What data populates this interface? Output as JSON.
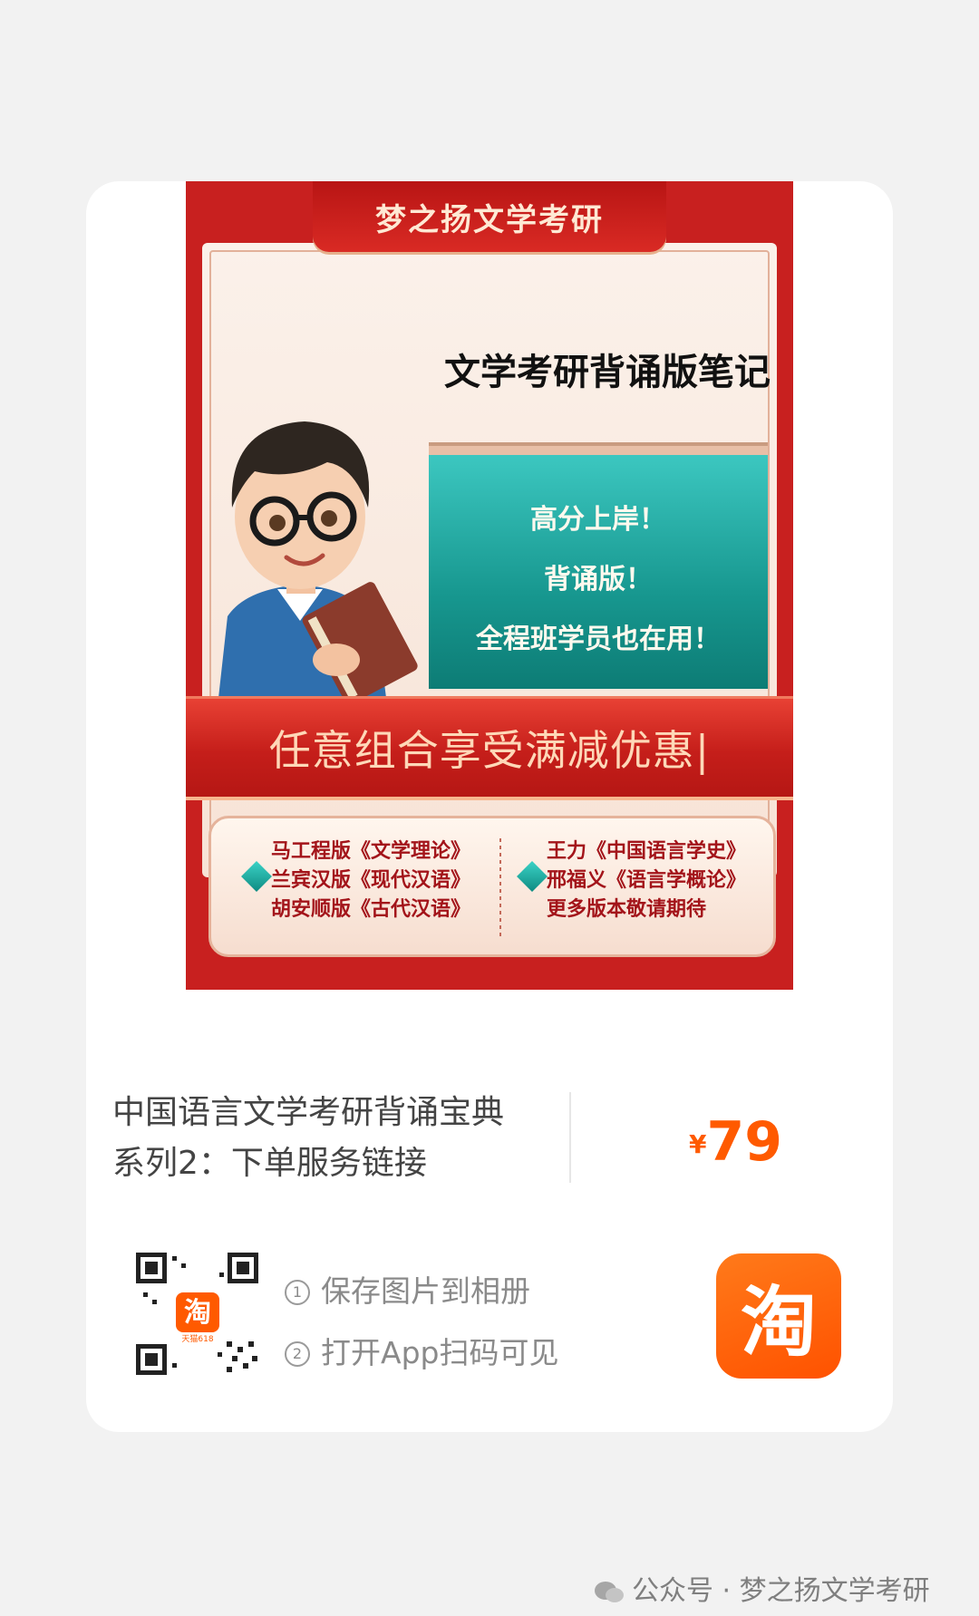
{
  "poster": {
    "banner": "梦之扬文学考研",
    "notes_title": "文学考研背诵版笔记",
    "teal_lines": [
      "高分上岸！",
      "背诵版！",
      "全程班学员也在用！"
    ],
    "promo": "任意组合享受满减优惠|",
    "editions_left": [
      "马工程版《文学理论》",
      "兰宾汉版《现代汉语》",
      "胡安顺版《古代汉语》"
    ],
    "editions_right": [
      "王力《中国语言学史》",
      "邢福义《语言学概论》",
      "更多版本敬请期待"
    ]
  },
  "product": {
    "title_line1": "中国语言文学考研背诵宝典",
    "title_line2": "系列2：下单服务链接",
    "currency": "¥",
    "price": "79"
  },
  "steps": {
    "step1_num": "1",
    "step1": "保存图片到相册",
    "step2_num": "2",
    "step2": "打开App扫码可见"
  },
  "qr": {
    "logo_text": "淘",
    "logo_caption": "天猫618"
  },
  "app_icon": {
    "glyph": "淘"
  },
  "watermark": {
    "text": "公众号 · 梦之扬文学考研"
  },
  "colors": {
    "accent": "#ff5a00",
    "poster_red": "#c8201f",
    "teal": "#17978f"
  }
}
